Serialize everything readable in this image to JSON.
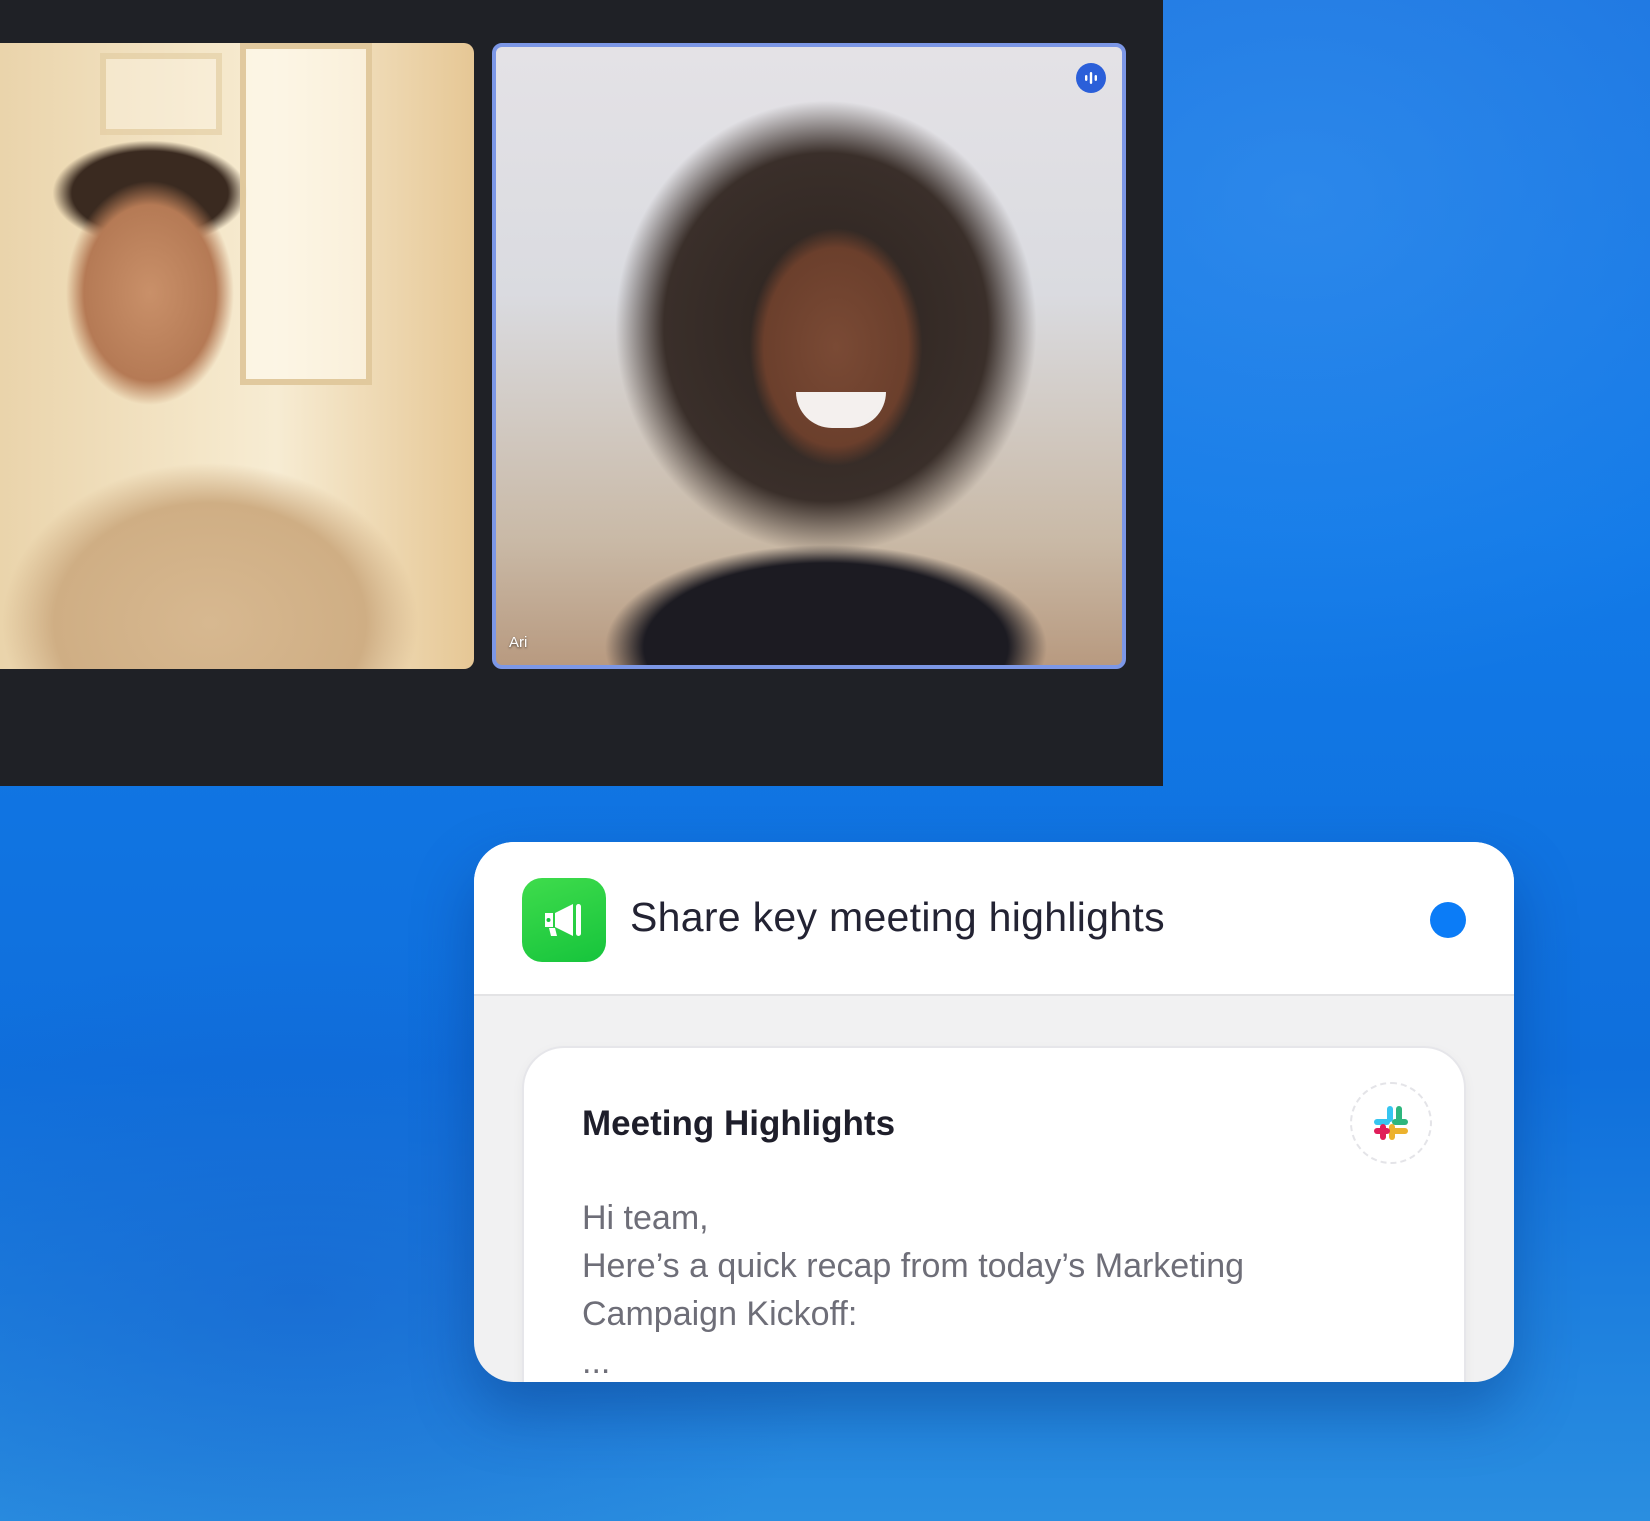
{
  "meeting": {
    "participants": [
      {
        "name": ""
      },
      {
        "name": "Ari",
        "speaking": true
      }
    ]
  },
  "workflow_card": {
    "title": "Share key meeting highlights",
    "app_icon": "megaphone-icon",
    "status_color": "#0b7cf7",
    "message": {
      "title": "Meeting Highlights",
      "integration_icon": "slack-icon",
      "lines": [
        "Hi team,",
        "Here’s a quick recap from today’s Marketing",
        "Campaign Kickoff:",
        "..."
      ]
    }
  },
  "colors": {
    "background": "#127ae8",
    "meeting_window": "#1f2126",
    "active_speaker_border": "#7c97e6",
    "app_icon_green": "#16c43c"
  }
}
